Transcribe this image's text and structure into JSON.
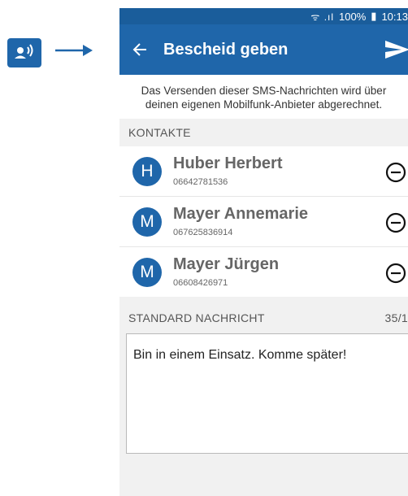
{
  "status": {
    "signal": "ᯤ .ıl",
    "battery": "100%",
    "time": "10:13"
  },
  "appbar": {
    "title": "Bescheid geben"
  },
  "info": {
    "line1": "Das Versenden dieser SMS-Nachrichten wird über",
    "line2": "deinen eigenen Mobilfunk-Anbieter abgerechnet."
  },
  "contacts_header": "KONTAKTE",
  "contacts": [
    {
      "initial": "H",
      "name": "Huber Herbert",
      "phone": "06642781536"
    },
    {
      "initial": "M",
      "name": "Mayer Annemarie",
      "phone": "067625836914"
    },
    {
      "initial": "M",
      "name": "Mayer Jürgen",
      "phone": "06608426971"
    }
  ],
  "message": {
    "header": "STANDARD NACHRICHT",
    "count": "35/1",
    "text": "Bin in einem Einsatz. Komme später!"
  },
  "colors": {
    "primary": "#1f66aa",
    "statusbar": "#1a5d9b",
    "background": "#f1f1f1"
  }
}
